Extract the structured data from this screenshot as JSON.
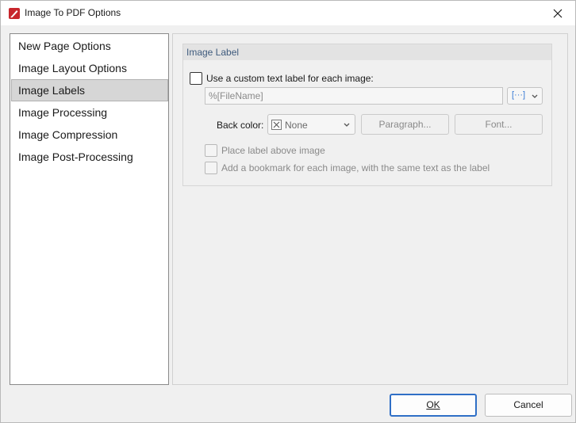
{
  "window": {
    "title": "Image To PDF Options"
  },
  "nav": {
    "items": [
      {
        "label": "New Page Options"
      },
      {
        "label": "Image Layout Options"
      },
      {
        "label": "Image Labels"
      },
      {
        "label": "Image Processing"
      },
      {
        "label": "Image Compression"
      },
      {
        "label": "Image Post-Processing"
      }
    ],
    "selected_index": 2
  },
  "image_label": {
    "group_title": "Image Label",
    "custom_label_checkbox": "Use a custom text label for each image:",
    "custom_label_checked": false,
    "label_value": "%[FileName]",
    "macro_button_glyph": "[···]",
    "back_color_label": "Back color:",
    "back_color_value": "None",
    "paragraph_button": "Paragraph...",
    "font_button": "Font...",
    "place_above_checkbox": "Place label above image",
    "place_above_checked": false,
    "bookmark_checkbox": "Add a bookmark for each image, with the same text as the label",
    "bookmark_checked": false
  },
  "footer": {
    "ok_label": "OK",
    "cancel_label": "Cancel"
  },
  "colors": {
    "accent": "#2f6fc6",
    "header_text": "#3f5b7d",
    "app_icon": "#c8262c"
  }
}
